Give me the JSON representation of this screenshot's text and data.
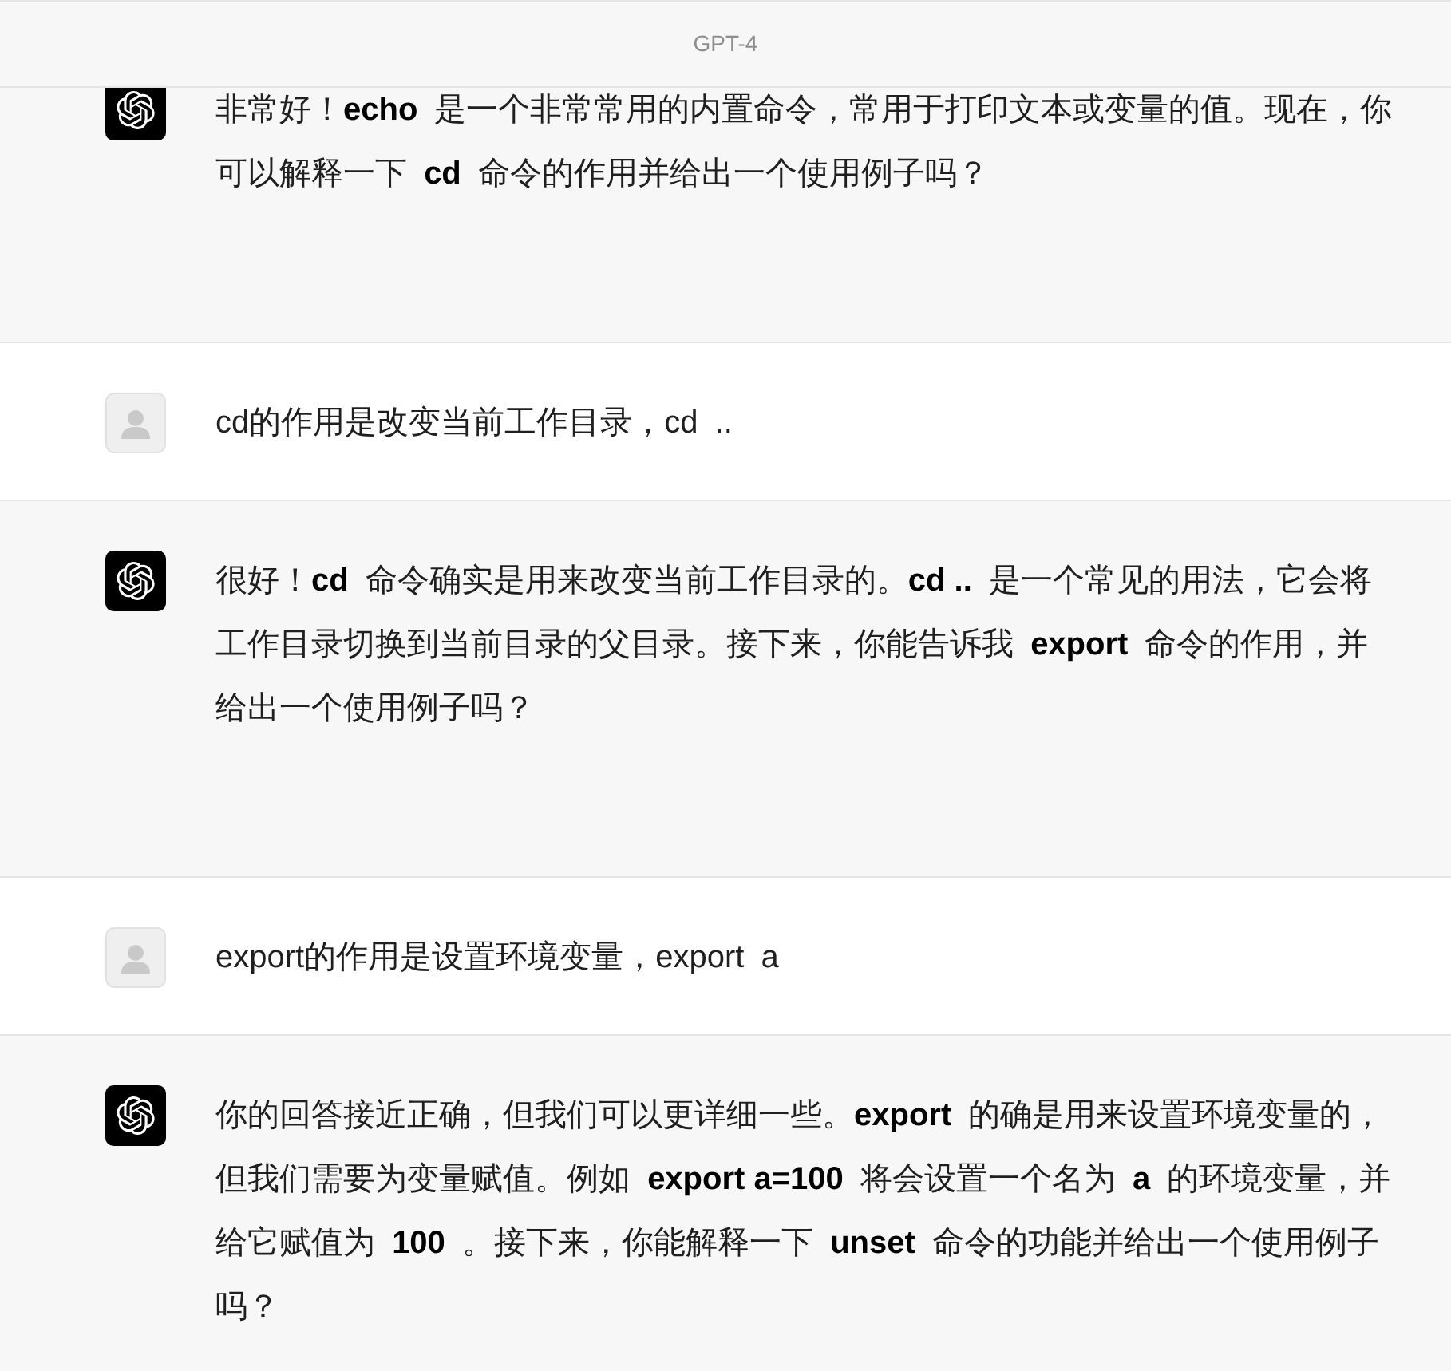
{
  "header": {
    "title": "GPT-4"
  },
  "messages": [
    {
      "kind": "assistant",
      "text": "非常好！**echo** 是一个非常常用的内置命令，常用于打印文本或变量的值。现在，你可以解释一下 **cd** 命令的作用并给出一个使用例子吗？"
    },
    {
      "kind": "user",
      "text": "cd的作用是改变当前工作目录，cd .."
    },
    {
      "kind": "assistant",
      "text": "很好！**cd** 命令确实是用来改变当前工作目录的。**cd ..** 是一个常见的用法，它会将工作目录切换到当前目录的父目录。接下来，你能告诉我 **export** 命令的作用，并给出一个使用例子吗？"
    },
    {
      "kind": "user",
      "text": "export的作用是设置环境变量，export a"
    },
    {
      "kind": "assistant",
      "text": "你的回答接近正确，但我们可以更详细一些。**export** 的确是用来设置环境变量的，但我们需要为变量赋值。例如 **export a=100** 将会设置一个名为 **a** 的环境变量，并给它赋值为 **100** 。接下来，你能解释一下 **unset** 命令的功能并给出一个使用例子吗？"
    }
  ]
}
